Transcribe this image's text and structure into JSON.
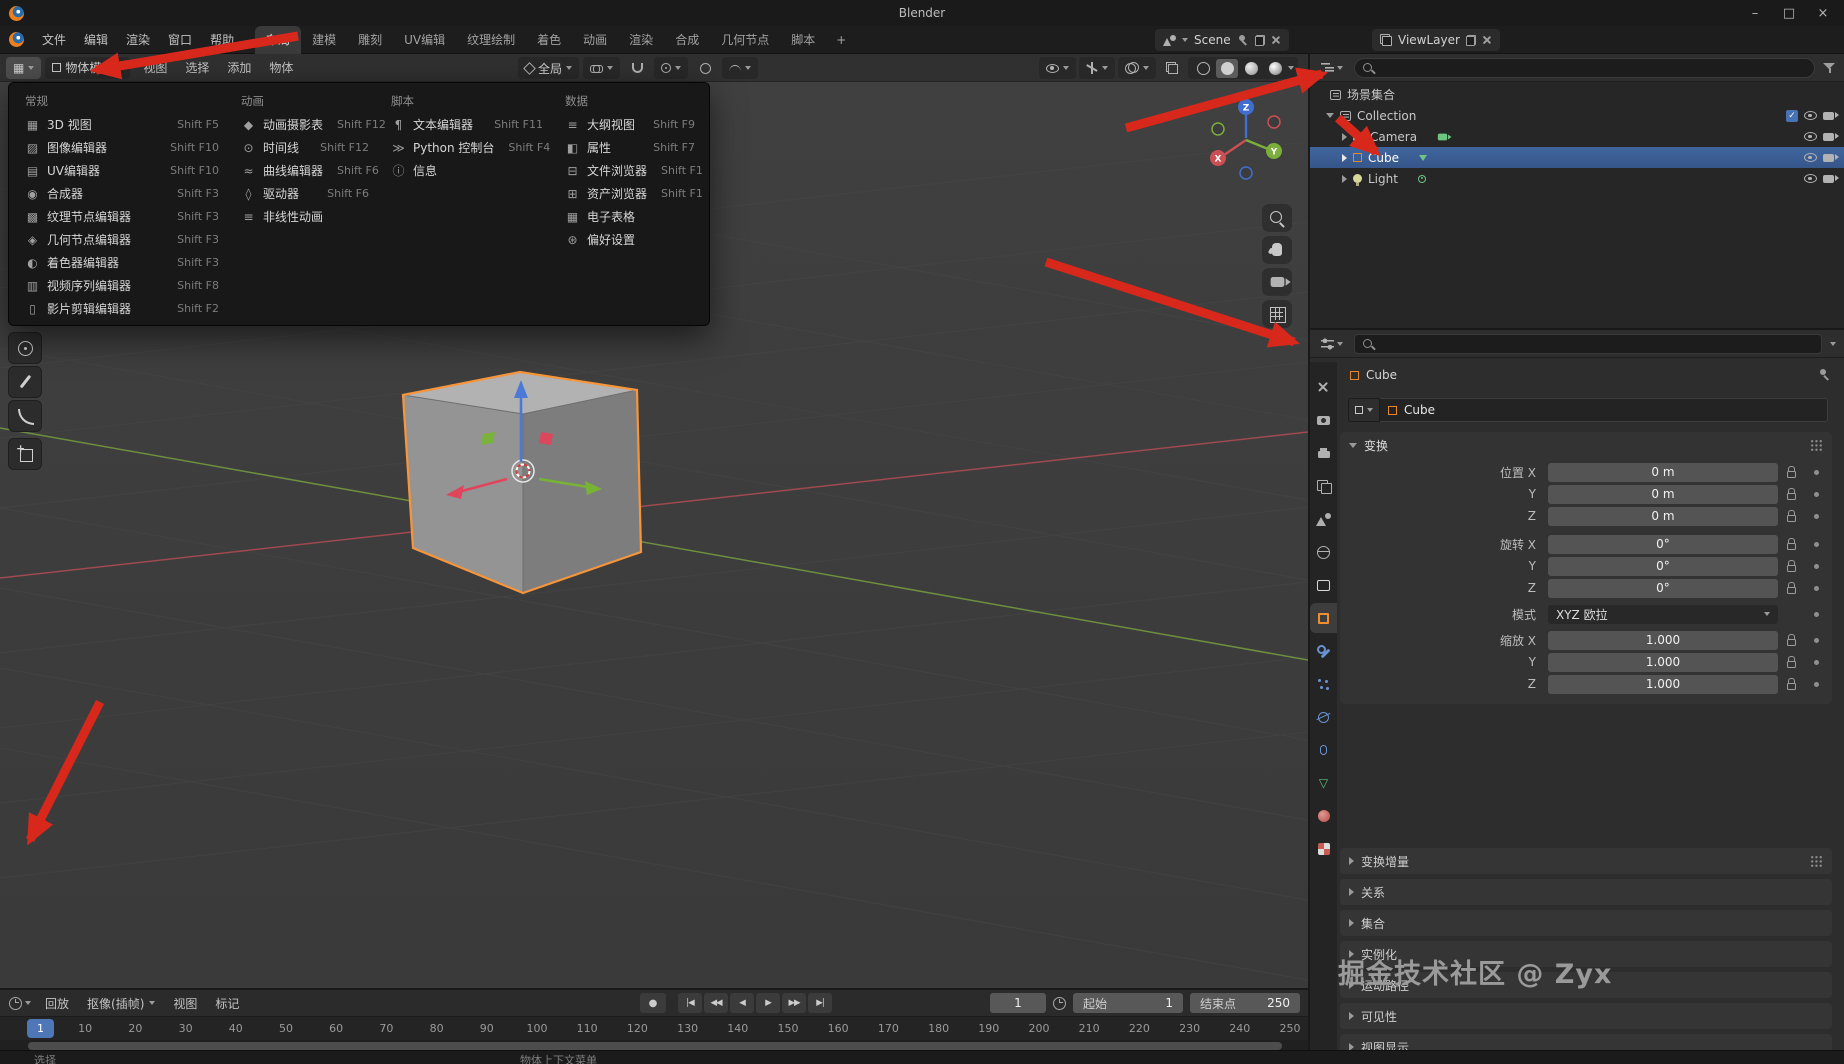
{
  "titlebar": {
    "title": "Blender",
    "minimize": "–",
    "maximize": "□",
    "close": "×"
  },
  "menubar": {
    "menus": [
      {
        "label": "文件"
      },
      {
        "label": "编辑"
      },
      {
        "label": "渲染"
      },
      {
        "label": "窗口"
      },
      {
        "label": "帮助"
      }
    ],
    "workspaces": [
      {
        "label": "布局",
        "active": true
      },
      {
        "label": "建模"
      },
      {
        "label": "雕刻"
      },
      {
        "label": "UV编辑"
      },
      {
        "label": "纹理绘制"
      },
      {
        "label": "着色"
      },
      {
        "label": "动画"
      },
      {
        "label": "渲染"
      },
      {
        "label": "合成"
      },
      {
        "label": "几何节点"
      },
      {
        "label": "脚本"
      }
    ],
    "add_workspace": "+",
    "scene_label": "Scene",
    "viewlayer_label": "ViewLayer"
  },
  "viewport": {
    "mode": "物体模式",
    "menus": [
      {
        "label": "视图"
      },
      {
        "label": "选择"
      },
      {
        "label": "添加"
      },
      {
        "label": "物体"
      }
    ],
    "orientation": "全局",
    "gizmo": {
      "x": "X",
      "y": "Y",
      "z": "Z"
    }
  },
  "editor_menu": {
    "columns": [
      {
        "header": "常规",
        "items": [
          {
            "label": "3D 视图",
            "shortcut": "Shift F5",
            "icon": "editor-3d"
          },
          {
            "label": "图像编辑器",
            "shortcut": "Shift F10",
            "icon": "editor-image"
          },
          {
            "label": "UV编辑器",
            "shortcut": "Shift F10",
            "icon": "editor-uv"
          },
          {
            "label": "合成器",
            "shortcut": "Shift F3",
            "icon": "editor-compositor"
          },
          {
            "label": "纹理节点编辑器",
            "shortcut": "Shift F3",
            "icon": "editor-texnode"
          },
          {
            "label": "几何节点编辑器",
            "shortcut": "Shift F3",
            "icon": "editor-geonode"
          },
          {
            "label": "着色器编辑器",
            "shortcut": "Shift F3",
            "icon": "editor-shader"
          },
          {
            "label": "视频序列编辑器",
            "shortcut": "Shift F8",
            "icon": "editor-sequencer"
          },
          {
            "label": "影片剪辑编辑器",
            "shortcut": "Shift F2",
            "icon": "editor-clip"
          }
        ]
      },
      {
        "header": "动画",
        "items": [
          {
            "label": "动画摄影表",
            "shortcut": "Shift F12",
            "icon": "editor-dopesheet"
          },
          {
            "label": "时间线",
            "shortcut": "Shift F12",
            "icon": "editor-timeline"
          },
          {
            "label": "曲线编辑器",
            "shortcut": "Shift F6",
            "icon": "editor-graph"
          },
          {
            "label": "驱动器",
            "shortcut": "Shift F6",
            "icon": "editor-drivers"
          },
          {
            "label": "非线性动画",
            "shortcut": "",
            "icon": "editor-nla"
          }
        ]
      },
      {
        "header": "脚本",
        "items": [
          {
            "label": "文本编辑器",
            "shortcut": "Shift F11",
            "icon": "editor-text"
          },
          {
            "label": "Python 控制台",
            "shortcut": "Shift F4",
            "icon": "editor-console"
          },
          {
            "label": "信息",
            "shortcut": "",
            "icon": "editor-info"
          }
        ]
      },
      {
        "header": "数据",
        "items": [
          {
            "label": "大纲视图",
            "shortcut": "Shift F9",
            "icon": "editor-outliner"
          },
          {
            "label": "属性",
            "shortcut": "Shift F7",
            "icon": "editor-properties"
          },
          {
            "label": "文件浏览器",
            "shortcut": "Shift F1",
            "icon": "editor-files"
          },
          {
            "label": "资产浏览器",
            "shortcut": "Shift F1",
            "icon": "editor-assets"
          },
          {
            "label": "电子表格",
            "shortcut": "",
            "icon": "editor-spreadsheet"
          },
          {
            "label": "偏好设置",
            "shortcut": "",
            "icon": "editor-prefs"
          }
        ]
      }
    ]
  },
  "outliner": {
    "check_glyph": "✓",
    "rows": {
      "scene_collection": "场景集合",
      "collection": "Collection",
      "camera": "Camera",
      "cube": "Cube",
      "light": "Light"
    }
  },
  "properties": {
    "breadcrumb": "Cube",
    "object_name": "Cube",
    "transform": {
      "title": "变换",
      "location": [
        {
          "label": "位置 X",
          "value": "0 m"
        },
        {
          "label": "Y",
          "value": "0 m"
        },
        {
          "label": "Z",
          "value": "0 m"
        }
      ],
      "rotation": [
        {
          "label": "旋转 X",
          "value": "0°"
        },
        {
          "label": "Y",
          "value": "0°"
        },
        {
          "label": "Z",
          "value": "0°"
        }
      ],
      "mode_label": "模式",
      "mode_value": "XYZ 欧拉",
      "scale": [
        {
          "label": "缩放 X",
          "value": "1.000"
        },
        {
          "label": "Y",
          "value": "1.000"
        },
        {
          "label": "Z",
          "value": "1.000"
        }
      ]
    },
    "sections": [
      {
        "label": "变换增量",
        "grip": true
      },
      {
        "label": "关系"
      },
      {
        "label": "集合"
      },
      {
        "label": "实例化"
      },
      {
        "label": "运动路径"
      },
      {
        "label": "可见性"
      },
      {
        "label": "视图显示"
      }
    ]
  },
  "timeline": {
    "menus": [
      {
        "label": "回放"
      },
      {
        "label": "抠像(插帧)",
        "caret": true
      },
      {
        "label": "视图"
      },
      {
        "label": "标记"
      }
    ],
    "record_glyph": "●",
    "transport": [
      {
        "name": "jump-to-start-button",
        "glyph": "|◀"
      },
      {
        "name": "prev-keyframe-button",
        "glyph": "◀◀"
      },
      {
        "name": "play-reverse-button",
        "glyph": "◀"
      },
      {
        "name": "play-button",
        "glyph": "▶"
      },
      {
        "name": "next-keyframe-button",
        "glyph": "▶▶"
      },
      {
        "name": "jump-to-end-button",
        "glyph": "▶|"
      }
    ],
    "current_frame": "1",
    "start_label": "起始",
    "start_value": "1",
    "end_label": "结束点",
    "end_value": "250",
    "ruler": [
      {
        "f": 10,
        "label": "10"
      },
      {
        "f": 20,
        "label": "20"
      },
      {
        "f": 30,
        "label": "30"
      },
      {
        "f": 40,
        "label": "40"
      },
      {
        "f": 50,
        "label": "50"
      },
      {
        "f": 60,
        "label": "60"
      },
      {
        "f": 70,
        "label": "70"
      },
      {
        "f": 80,
        "label": "80"
      },
      {
        "f": 90,
        "label": "90"
      },
      {
        "f": 100,
        "label": "100"
      },
      {
        "f": 110,
        "label": "110"
      },
      {
        "f": 120,
        "label": "120"
      },
      {
        "f": 130,
        "label": "130"
      },
      {
        "f": 140,
        "label": "140"
      },
      {
        "f": 150,
        "label": "150"
      },
      {
        "f": 160,
        "label": "160"
      },
      {
        "f": 170,
        "label": "170"
      },
      {
        "f": 180,
        "label": "180"
      },
      {
        "f": 190,
        "label": "190"
      },
      {
        "f": 200,
        "label": "200"
      },
      {
        "f": 210,
        "label": "210"
      },
      {
        "f": 220,
        "label": "220"
      },
      {
        "f": 230,
        "label": "230"
      },
      {
        "f": 240,
        "label": "240"
      },
      {
        "f": 250,
        "label": "250"
      }
    ]
  },
  "statusbar": {
    "hints": [
      {
        "label": "选择"
      },
      {
        "label": "物体上下文菜单"
      }
    ]
  },
  "watermark": "掘金技术社区 @ Zyx"
}
